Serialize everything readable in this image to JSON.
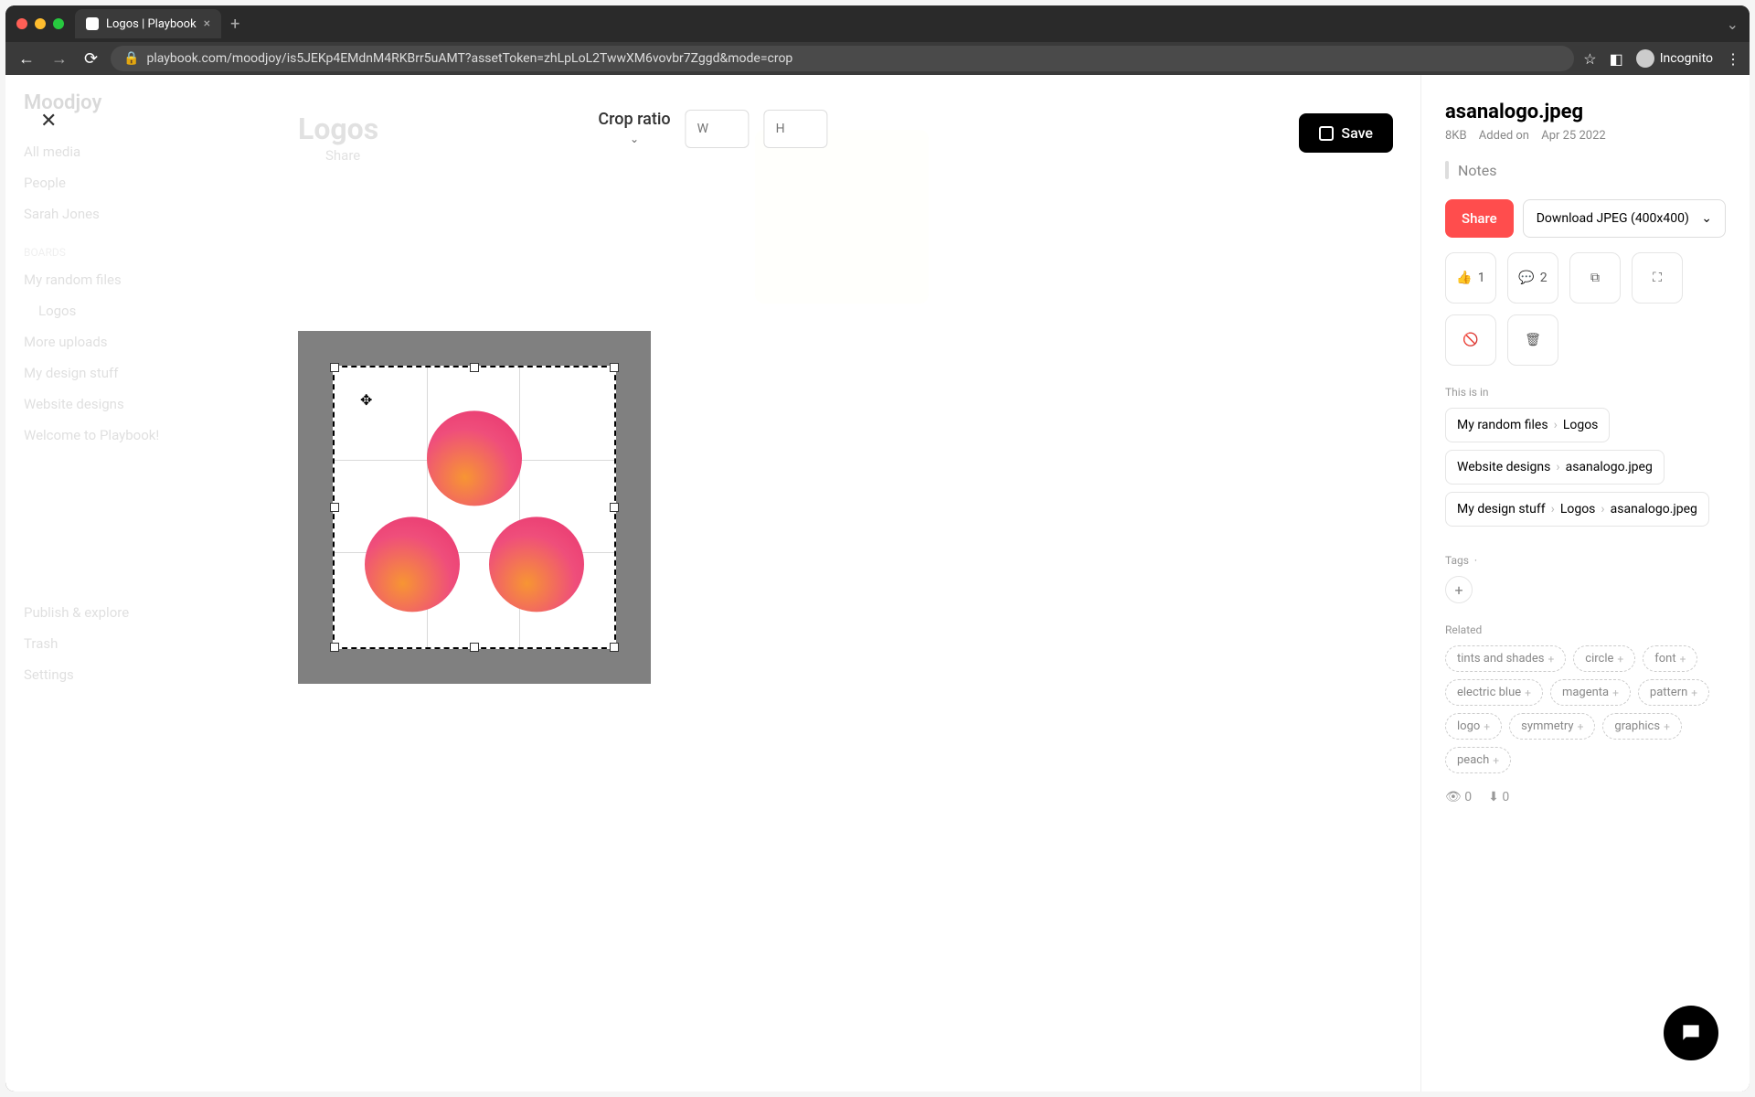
{
  "browser": {
    "tab_title": "Logos | Playbook",
    "url": "playbook.com/moodjoy/is5JEKp4EMdnM4RKBrr5uAMT?assetToken=zhLpLoL2TwwXM6vovbr7Zggd&mode=crop",
    "incognito_label": "Incognito"
  },
  "bg_sidebar": {
    "brand": "Moodjoy",
    "items": [
      "All media",
      "People",
      "Sarah Jones"
    ],
    "section1_label": "Boards",
    "boards": [
      "My random files",
      "Logos",
      "More uploads",
      "My design stuff",
      "Website designs",
      "Welcome to Playbook!"
    ],
    "footer": [
      "Publish & explore",
      "Trash",
      "Settings"
    ]
  },
  "bg_main": {
    "title": "Logos",
    "share": "Share"
  },
  "editor": {
    "crop_label": "Crop ratio",
    "w_placeholder": "W",
    "h_placeholder": "H",
    "save_label": "Save"
  },
  "details": {
    "filename": "asanalogo.jpeg",
    "size": "8KB",
    "added_label": "Added on",
    "added_date": "Apr 25 2022",
    "notes_label": "Notes",
    "share_label": "Share",
    "download_label": "Download JPEG (400x400)",
    "reaction_emoji": "👍",
    "reaction_count": "1",
    "comment_count": "2",
    "this_is_in_label": "This is in",
    "breadcrumbs": [
      [
        "My random files",
        "Logos"
      ],
      [
        "Website designs",
        "asanalogo.jpeg"
      ],
      [
        "My design stuff",
        "Logos",
        "asanalogo.jpeg"
      ]
    ],
    "tags_label": "Tags",
    "related_label": "Related",
    "related_tags": [
      "tints and shades",
      "circle",
      "font",
      "electric blue",
      "magenta",
      "pattern",
      "logo",
      "symmetry",
      "graphics",
      "peach"
    ],
    "views": "0",
    "downloads": "0"
  }
}
